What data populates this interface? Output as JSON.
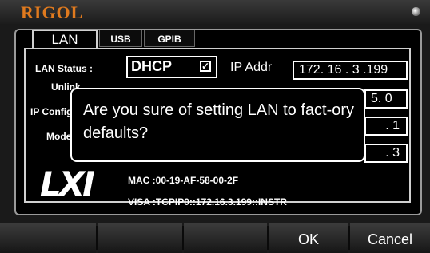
{
  "brand": {
    "logo_text": "RIGOL"
  },
  "tabs": [
    {
      "label": "LAN",
      "active": true
    },
    {
      "label": "USB",
      "active": false
    },
    {
      "label": "GPIB",
      "active": false
    }
  ],
  "lan": {
    "status_label": "LAN Status :",
    "status_value": "Unlink",
    "ip_config_label": "IP Config",
    "mode_label": "Mode",
    "dhcp_label": "DHCP",
    "dhcp_checked": true,
    "ip_addr_label": "IP Addr",
    "ip_addr_value": "172. 16 . 3 .199",
    "field2_visible": "5. 0",
    "field3_visible": ". 1",
    "field4_visible": ". 3",
    "mac_text": "MAC :00-19-AF-58-00-2F",
    "visa_text": "VISA :TCPIP0::172.16.3.199::INSTR",
    "logo_text": "LXI"
  },
  "dialog": {
    "message": "Are you sure of setting LAN to fact-ory defaults?"
  },
  "softkeys": [
    {
      "label": ""
    },
    {
      "label": ""
    },
    {
      "label": ""
    },
    {
      "label": "OK"
    },
    {
      "label": "Cancel"
    }
  ]
}
